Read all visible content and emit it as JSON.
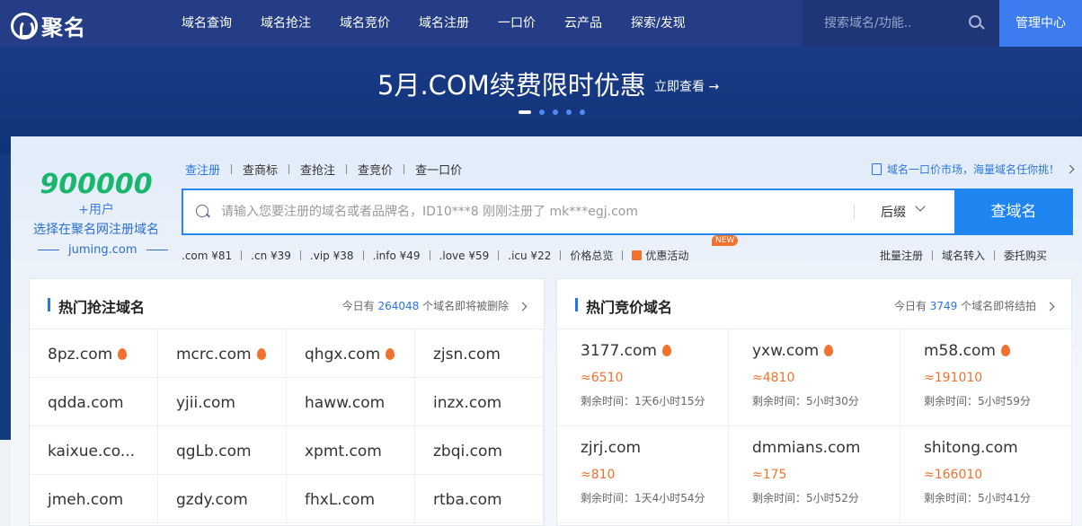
{
  "header": {
    "logo_text": "聚名",
    "nav": [
      "域名查询",
      "域名抢注",
      "域名竞价",
      "域名注册",
      "一口价",
      "云产品",
      "探索/发现"
    ],
    "search_placeholder": "搜索域名/功能..",
    "admin_label": "管理中心"
  },
  "banner": {
    "title": "5月.COM续费限时优惠",
    "link": "立即查看 →",
    "dots": 5,
    "active_dot": 1
  },
  "promo": {
    "number": "900000",
    "plus": "+用户",
    "subtitle": "选择在聚名网注册域名",
    "site": "juming.com"
  },
  "search": {
    "tabs": [
      "查注册",
      "查商标",
      "查抢注",
      "查竞价",
      "查一口价"
    ],
    "active_tab": 0,
    "market_link": "域名一口价市场，海量域名任你挑！",
    "placeholder": "请输入您要注册的域名或者品牌名，ID10***8 刚刚注册了 mk***egj.com",
    "suffix_label": "后缀",
    "button_label": "查域名",
    "prices": [
      ".com ¥81",
      ".cn ¥39",
      ".vip ¥38",
      ".info ¥49",
      ".love ¥59",
      ".icu ¥22",
      "价格总览"
    ],
    "promo_label": "优惠活动",
    "new_badge": "NEW",
    "right_links": [
      "批量注册",
      "域名转入",
      "委托购买"
    ]
  },
  "hot_register": {
    "title": "热门抢注域名",
    "note_prefix": "今日有",
    "count": "264048",
    "note_suffix": "个域名即将被删除",
    "domains": [
      {
        "name": "8pz.com",
        "hot": true
      },
      {
        "name": "mcrc.com",
        "hot": true
      },
      {
        "name": "qhgx.com",
        "hot": true
      },
      {
        "name": "zjsn.com",
        "hot": false
      },
      {
        "name": "qdda.com",
        "hot": false
      },
      {
        "name": "yjii.com",
        "hot": false
      },
      {
        "name": "haww.com",
        "hot": false
      },
      {
        "name": "inzx.com",
        "hot": false
      },
      {
        "name": "kaixue.co...",
        "hot": false
      },
      {
        "name": "qgLb.com",
        "hot": false
      },
      {
        "name": "xpmt.com",
        "hot": false
      },
      {
        "name": "zbqi.com",
        "hot": false
      },
      {
        "name": "jmeh.com",
        "hot": false
      },
      {
        "name": "gzdy.com",
        "hot": false
      },
      {
        "name": "fhxL.com",
        "hot": false
      },
      {
        "name": "rtba.com",
        "hot": false
      }
    ]
  },
  "hot_bid": {
    "title": "热门竞价域名",
    "note_prefix": "今日有",
    "count": "3749",
    "note_suffix": "个域名即将结拍",
    "time_prefix": "剩余时间：",
    "items": [
      {
        "name": "3177.com",
        "hot": true,
        "price": "≈6510",
        "time": "1天6小时15分"
      },
      {
        "name": "yxw.com",
        "hot": true,
        "price": "≈4810",
        "time": "5小时30分"
      },
      {
        "name": "m58.com",
        "hot": true,
        "price": "≈191010",
        "time": "5小时59分"
      },
      {
        "name": "zjrj.com",
        "hot": false,
        "price": "≈810",
        "time": "1天4小时54分"
      },
      {
        "name": "dmmians.com",
        "hot": false,
        "price": "≈175",
        "time": "5小时52分"
      },
      {
        "name": "shitong.com",
        "hot": false,
        "price": "≈166010",
        "time": "5小时41分"
      }
    ]
  },
  "colors": {
    "header_bg": "#253c86",
    "accent": "#2a75e6",
    "admin_bg": "#3c7bf0",
    "green": "#19b66c",
    "orange": "#f0722e"
  }
}
